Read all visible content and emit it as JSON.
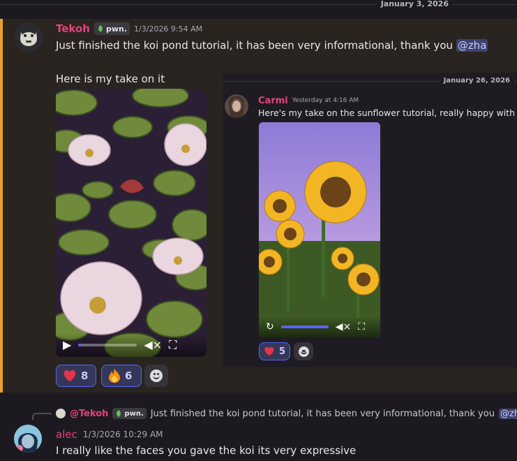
{
  "top_divider": {
    "date": "January 3, 2026"
  },
  "message1": {
    "username": "Tekoh",
    "username_color": "#e8417a",
    "tag": "pwn.",
    "timestamp": "1/3/2026 9:54 AM",
    "line1": "Just finished the koi pond tutorial, it has been very informational, thank you",
    "mention": "@zha",
    "line2": "Here is my take on it",
    "reactions": [
      {
        "emoji": "heart",
        "count": "8"
      },
      {
        "emoji": "fire",
        "count": "6"
      }
    ]
  },
  "inner_shot": {
    "date": "January 26, 2026",
    "username": "Carmi",
    "username_color": "#e8417a",
    "timestamp": "Yesterday at 4:16 AM",
    "text": "Here's my take on the sunflower tutorial, really happy with it!",
    "reaction_count": "5"
  },
  "message2": {
    "reply_username": "@Tekoh",
    "reply_tag": "pwn.",
    "reply_text": "Just finished the koi pond tutorial, it has been very informational, thank you",
    "reply_mention": "@zh",
    "username": "alec",
    "username_color": "#e8417a",
    "timestamp": "1/3/2026 10:29 AM",
    "text": "I really like the faces you gave the koi its very expressive"
  },
  "colors": {
    "accent": "#5865f2",
    "highlight_border": "#e6a12c"
  }
}
